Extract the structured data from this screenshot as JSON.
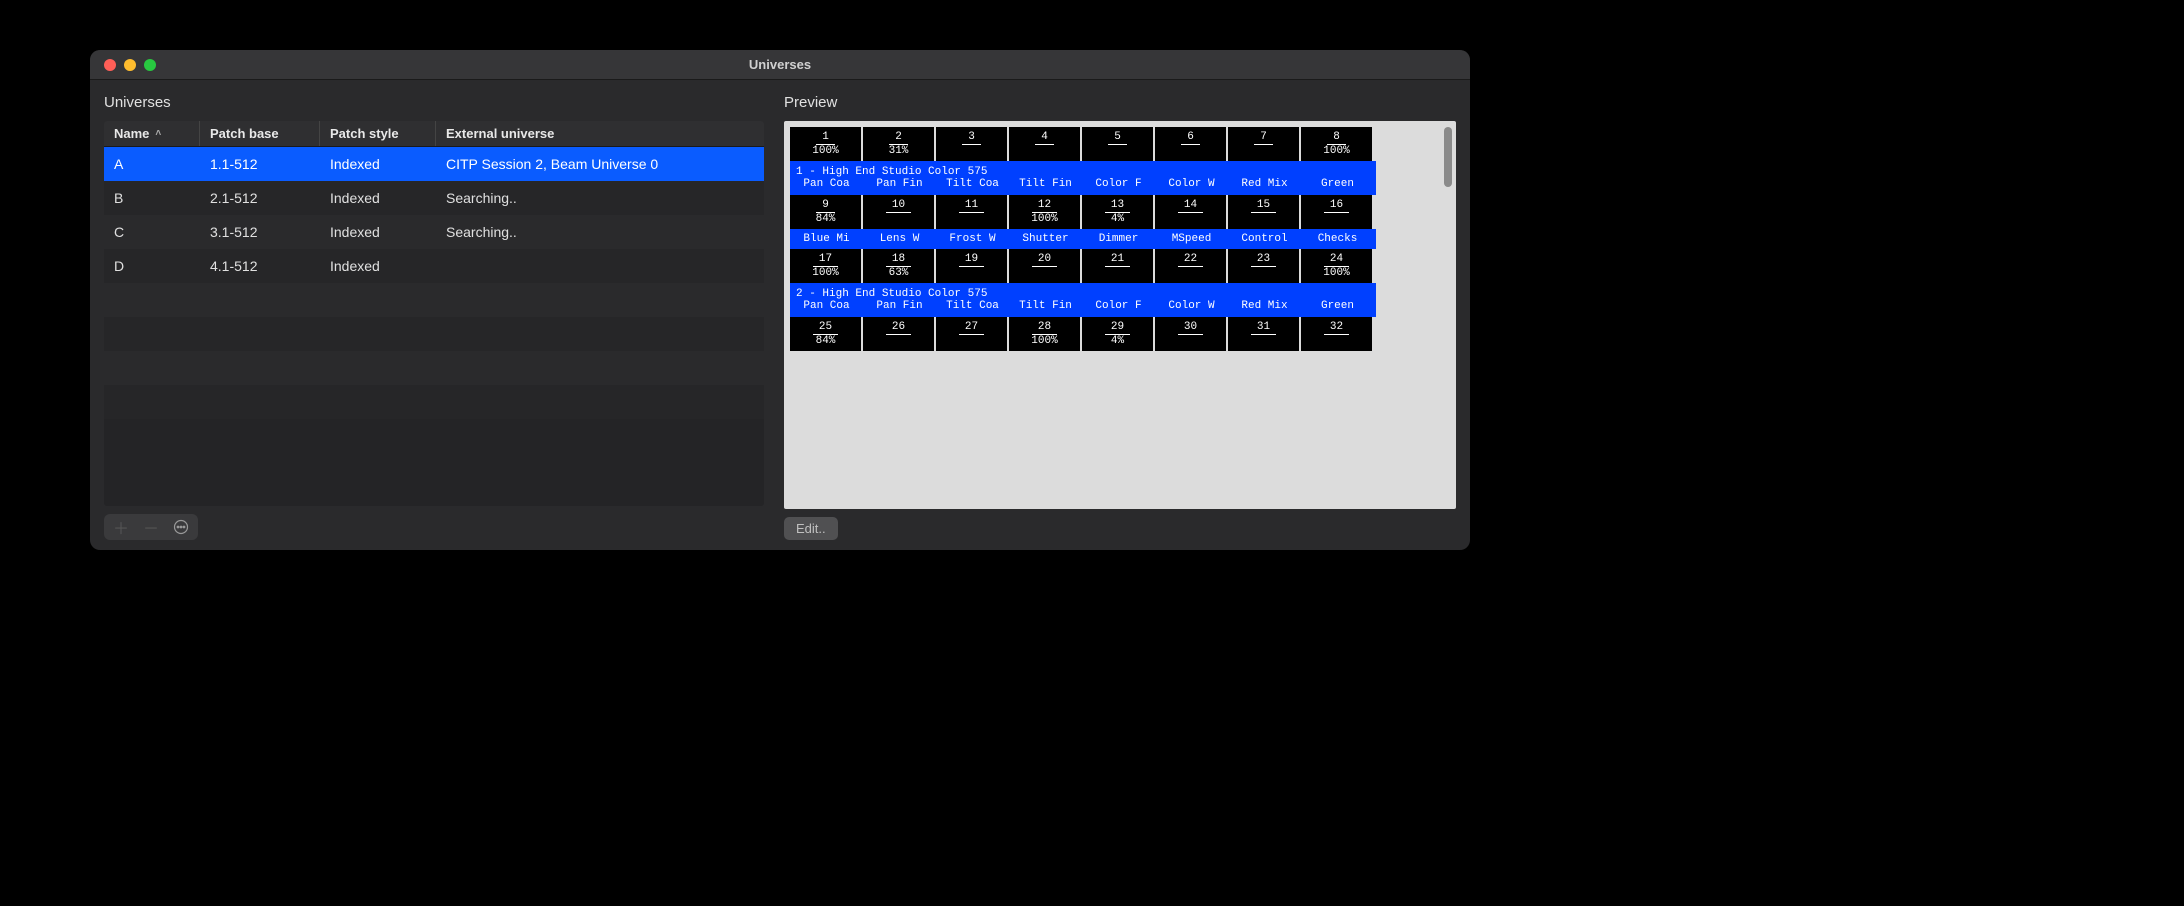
{
  "window": {
    "title": "Universes"
  },
  "left": {
    "title": "Universes",
    "columns": {
      "name": "Name",
      "patch_base": "Patch base",
      "patch_style": "Patch style",
      "external": "External universe"
    },
    "rows": [
      {
        "name": "A",
        "patch_base": "1.1-512",
        "patch_style": "Indexed",
        "external": "CITP Session 2, Beam Universe 0",
        "selected": true
      },
      {
        "name": "B",
        "patch_base": "2.1-512",
        "patch_style": "Indexed",
        "external": "Searching..",
        "selected": false
      },
      {
        "name": "C",
        "patch_base": "3.1-512",
        "patch_style": "Indexed",
        "external": "Searching..",
        "selected": false
      },
      {
        "name": "D",
        "patch_base": "4.1-512",
        "patch_style": "Indexed",
        "external": "",
        "selected": false
      }
    ]
  },
  "right": {
    "title": "Preview",
    "edit_label": "Edit..",
    "fixtures": [
      {
        "title": "1 - High End Studio Color 575",
        "labels": [
          "Pan Coa",
          "Pan Fin",
          "Tilt Coa",
          "Tilt Fin",
          "Color F",
          "Color W",
          "Red Mix",
          "Green"
        ]
      },
      {
        "title": "",
        "labels": [
          "Blue Mi",
          "Lens W",
          "Frost W",
          "Shutter",
          "Dimmer",
          "MSpeed",
          "Control",
          "Checks"
        ]
      },
      {
        "title": "2 - High End Studio Color 575",
        "labels": [
          "Pan Coa",
          "Pan Fin",
          "Tilt Coa",
          "Tilt Fin",
          "Color F",
          "Color W",
          "Red Mix",
          "Green"
        ]
      }
    ],
    "channel_rows": [
      [
        {
          "n": 1,
          "v": "100%"
        },
        {
          "n": 2,
          "v": "31%"
        },
        {
          "n": 3,
          "v": ""
        },
        {
          "n": 4,
          "v": ""
        },
        {
          "n": 5,
          "v": ""
        },
        {
          "n": 6,
          "v": ""
        },
        {
          "n": 7,
          "v": ""
        },
        {
          "n": 8,
          "v": "100%"
        }
      ],
      [
        {
          "n": 9,
          "v": "84%"
        },
        {
          "n": 10,
          "v": ""
        },
        {
          "n": 11,
          "v": ""
        },
        {
          "n": 12,
          "v": "100%"
        },
        {
          "n": 13,
          "v": "4%"
        },
        {
          "n": 14,
          "v": ""
        },
        {
          "n": 15,
          "v": ""
        },
        {
          "n": 16,
          "v": ""
        }
      ],
      [
        {
          "n": 17,
          "v": "100%"
        },
        {
          "n": 18,
          "v": "63%"
        },
        {
          "n": 19,
          "v": ""
        },
        {
          "n": 20,
          "v": ""
        },
        {
          "n": 21,
          "v": ""
        },
        {
          "n": 22,
          "v": ""
        },
        {
          "n": 23,
          "v": ""
        },
        {
          "n": 24,
          "v": "100%"
        }
      ],
      [
        {
          "n": 25,
          "v": "84%"
        },
        {
          "n": 26,
          "v": ""
        },
        {
          "n": 27,
          "v": ""
        },
        {
          "n": 28,
          "v": "100%"
        },
        {
          "n": 29,
          "v": "4%"
        },
        {
          "n": 30,
          "v": ""
        },
        {
          "n": 31,
          "v": ""
        },
        {
          "n": 32,
          "v": ""
        }
      ]
    ]
  }
}
